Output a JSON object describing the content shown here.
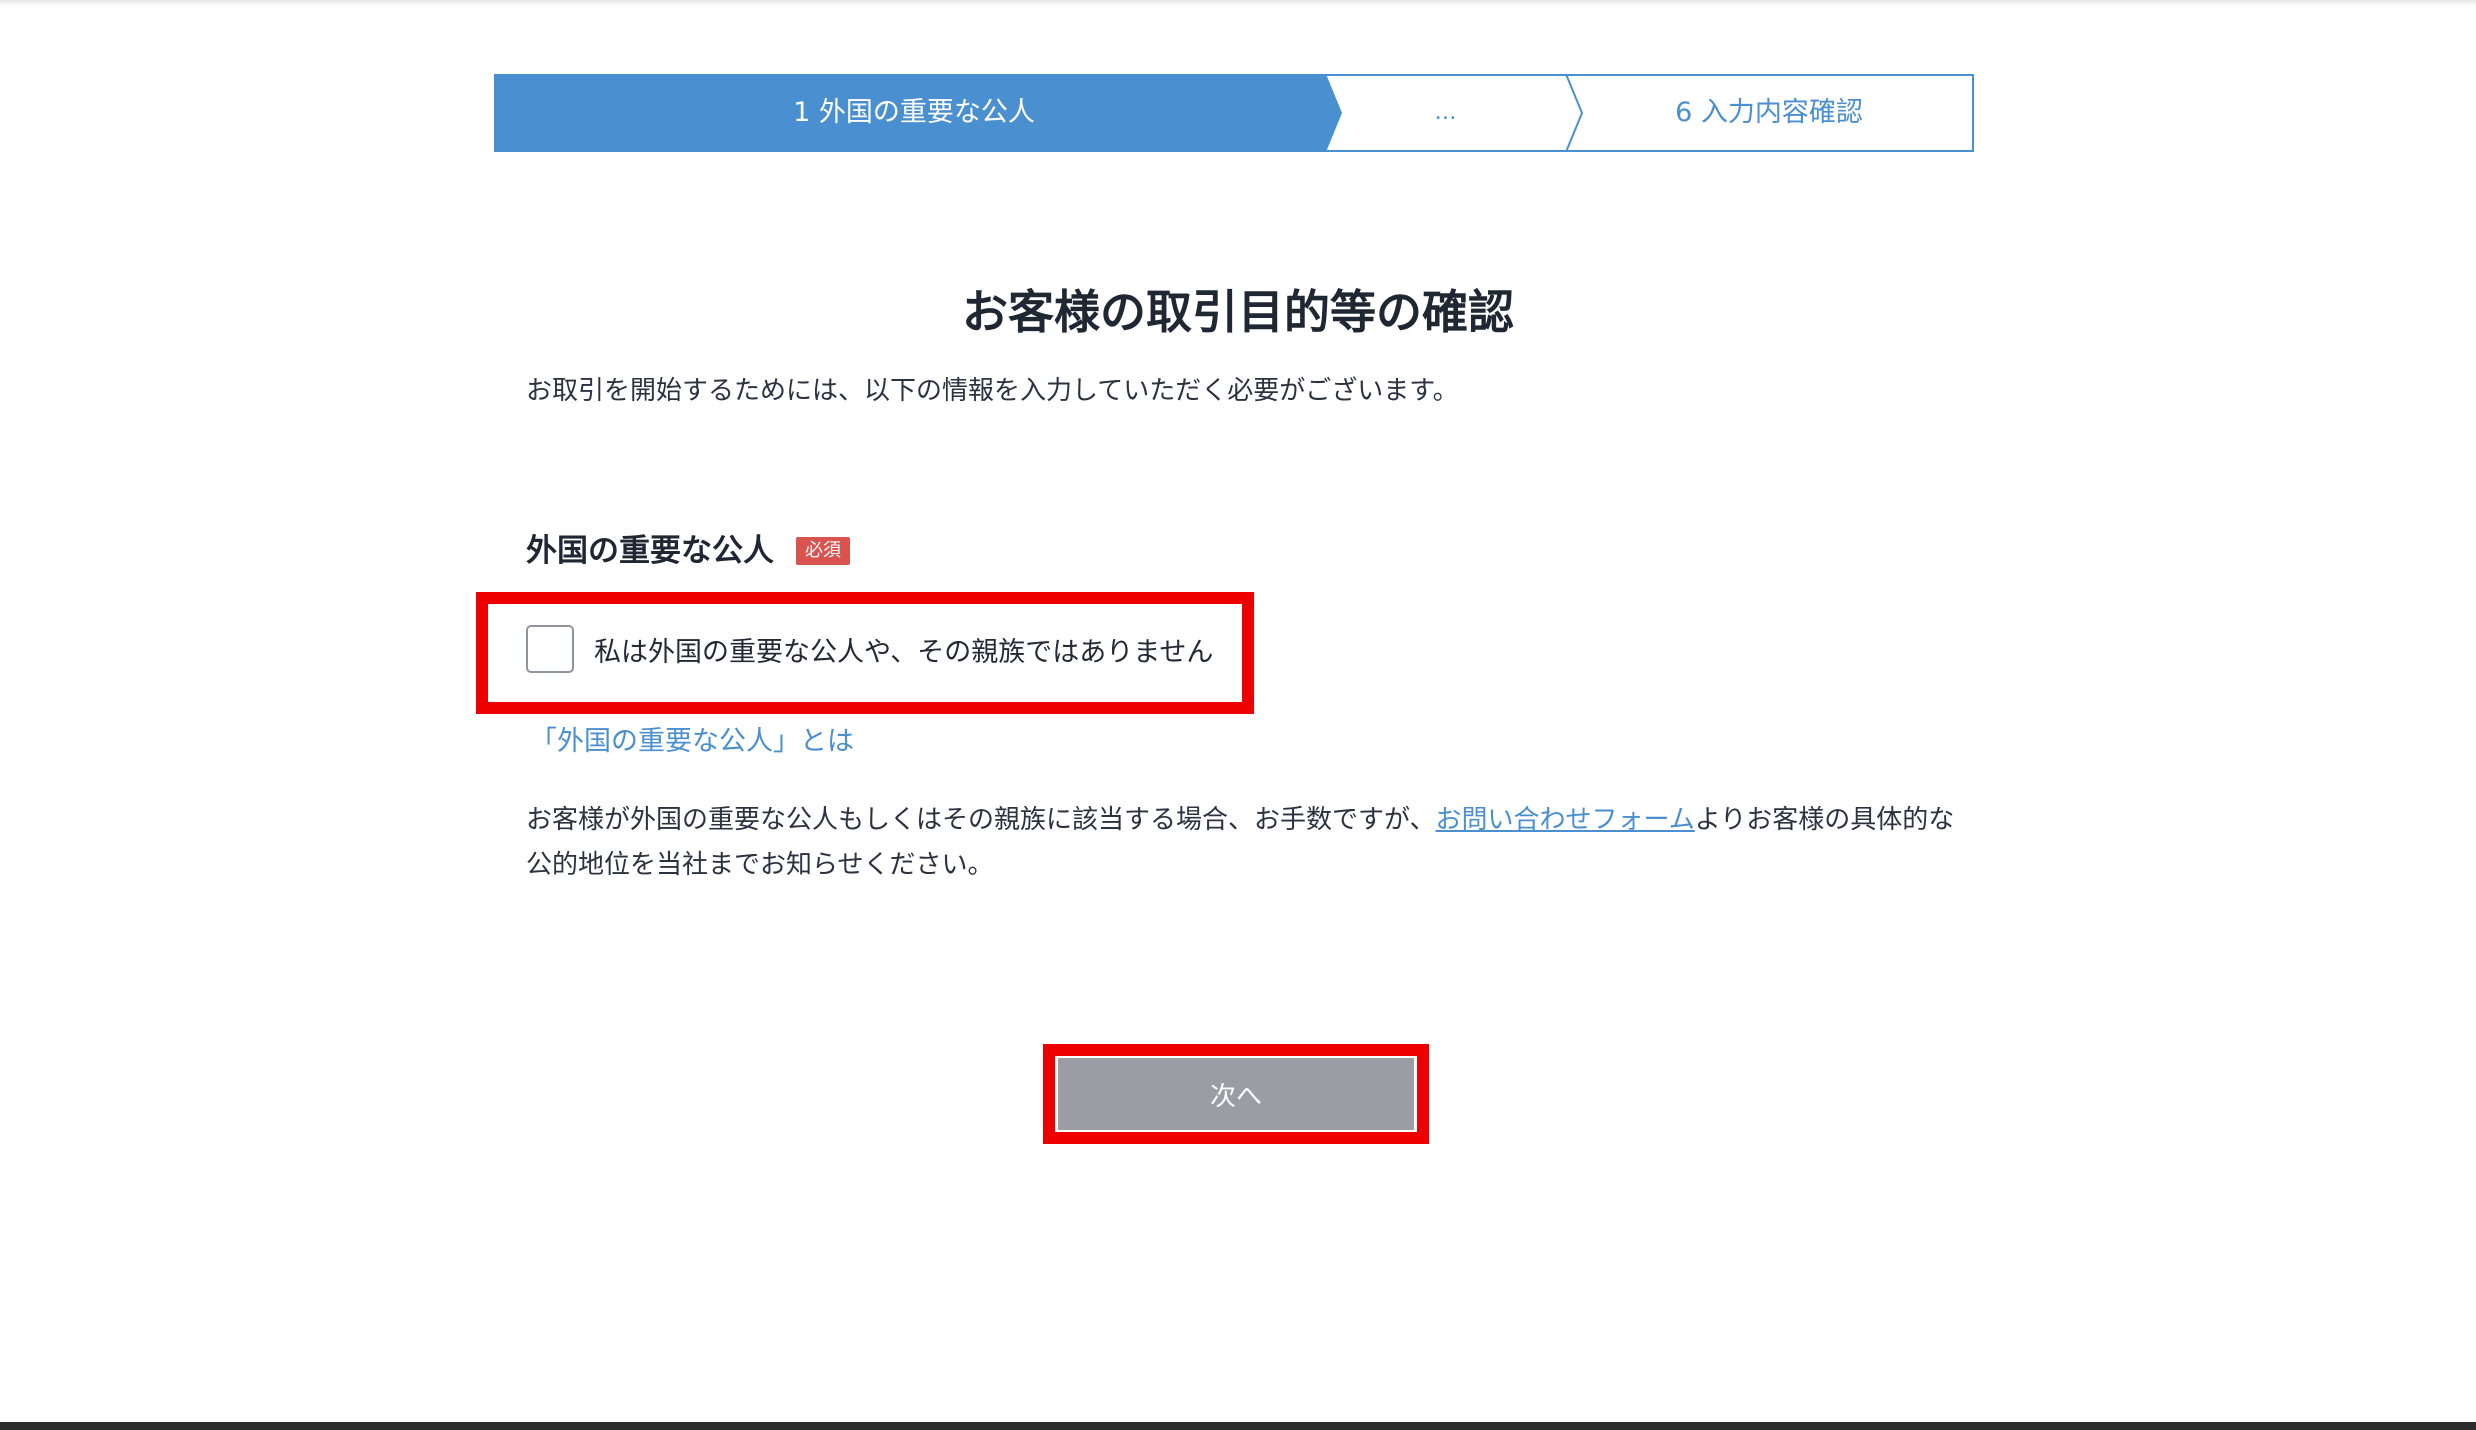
{
  "stepper": {
    "steps": [
      {
        "label": "1 外国の重要な公人",
        "state": "active"
      },
      {
        "label": "…",
        "state": "pending"
      },
      {
        "label": "6 入力内容確認",
        "state": "pending"
      }
    ],
    "active_color": "#4a8fcf"
  },
  "page": {
    "title": "お客様の取引目的等の確認",
    "intro": "お取引を開始するためには、以下の情報を入力していただく必要がございます。"
  },
  "section": {
    "heading": "外国の重要な公人",
    "required_badge": "必須",
    "checkbox_label": "私は外国の重要な公人や、その親族ではありません",
    "checkbox_checked": false,
    "info_link": "「外国の重要な公人」とは",
    "notice_before_link": "お客様が外国の重要な公人もしくはその親族に該当する場合、お手数ですが、",
    "notice_link": "お問い合わせフォーム",
    "notice_after_link": "よりお客様の具体的な公的地位を当社までお知らせください。"
  },
  "actions": {
    "next_label": "次へ"
  },
  "colors": {
    "link": "#4a8fcf",
    "badge": "#d9534f",
    "highlight": "#ee0000",
    "button_disabled": "#9a9ea4"
  }
}
